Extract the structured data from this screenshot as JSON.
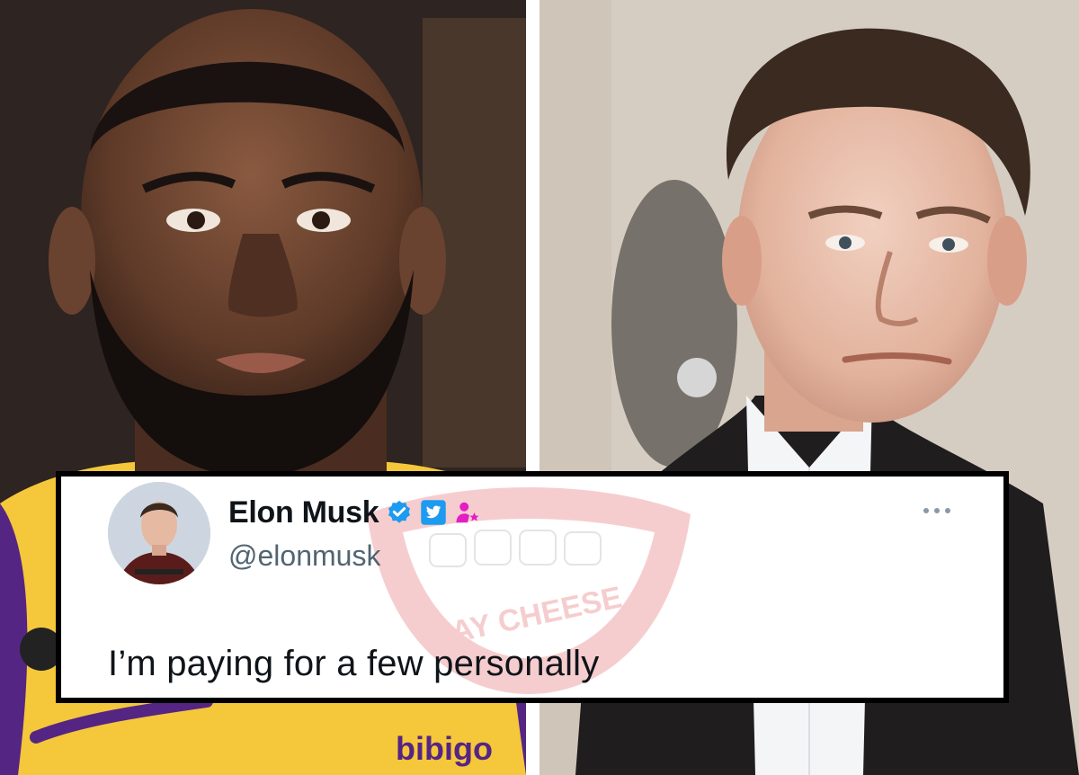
{
  "tweet": {
    "display_name": "Elon Musk",
    "handle": "@elonmusk",
    "text": "I’m paying for a few personally",
    "badges": [
      "verified-badge-icon",
      "twitter-bird-badge-icon",
      "affiliate-person-star-icon"
    ]
  },
  "watermark": {
    "text": "SAY CHEESE"
  },
  "jersey_text": {
    "sponsor": "bibigo"
  },
  "colors": {
    "verified_blue": "#1d9bf0",
    "affiliate_pink": "#e31ec4",
    "lakers_gold": "#f5c73b",
    "lakers_purple": "#552583"
  }
}
